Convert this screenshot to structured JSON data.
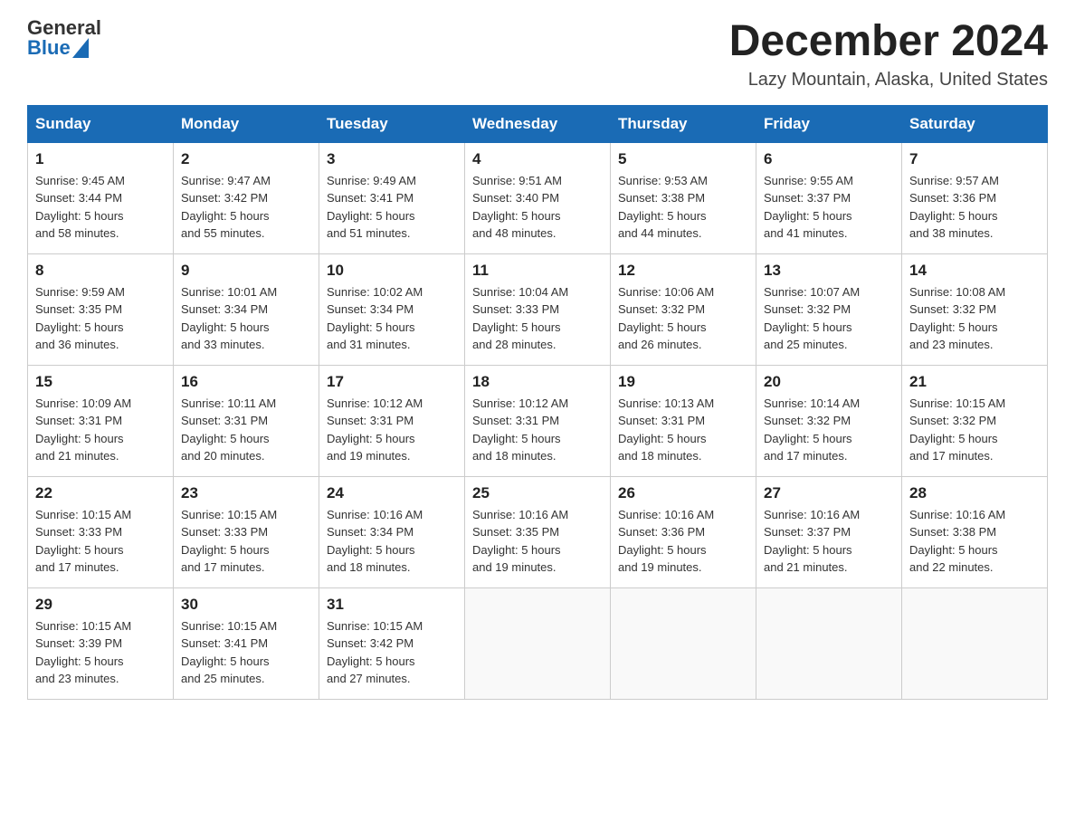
{
  "header": {
    "logo_general": "General",
    "logo_blue": "Blue",
    "month_title": "December 2024",
    "location": "Lazy Mountain, Alaska, United States"
  },
  "days_of_week": [
    "Sunday",
    "Monday",
    "Tuesday",
    "Wednesday",
    "Thursday",
    "Friday",
    "Saturday"
  ],
  "weeks": [
    [
      {
        "day": "1",
        "sunrise": "9:45 AM",
        "sunset": "3:44 PM",
        "daylight": "5 hours and 58 minutes."
      },
      {
        "day": "2",
        "sunrise": "9:47 AM",
        "sunset": "3:42 PM",
        "daylight": "5 hours and 55 minutes."
      },
      {
        "day": "3",
        "sunrise": "9:49 AM",
        "sunset": "3:41 PM",
        "daylight": "5 hours and 51 minutes."
      },
      {
        "day": "4",
        "sunrise": "9:51 AM",
        "sunset": "3:40 PM",
        "daylight": "5 hours and 48 minutes."
      },
      {
        "day": "5",
        "sunrise": "9:53 AM",
        "sunset": "3:38 PM",
        "daylight": "5 hours and 44 minutes."
      },
      {
        "day": "6",
        "sunrise": "9:55 AM",
        "sunset": "3:37 PM",
        "daylight": "5 hours and 41 minutes."
      },
      {
        "day": "7",
        "sunrise": "9:57 AM",
        "sunset": "3:36 PM",
        "daylight": "5 hours and 38 minutes."
      }
    ],
    [
      {
        "day": "8",
        "sunrise": "9:59 AM",
        "sunset": "3:35 PM",
        "daylight": "5 hours and 36 minutes."
      },
      {
        "day": "9",
        "sunrise": "10:01 AM",
        "sunset": "3:34 PM",
        "daylight": "5 hours and 33 minutes."
      },
      {
        "day": "10",
        "sunrise": "10:02 AM",
        "sunset": "3:34 PM",
        "daylight": "5 hours and 31 minutes."
      },
      {
        "day": "11",
        "sunrise": "10:04 AM",
        "sunset": "3:33 PM",
        "daylight": "5 hours and 28 minutes."
      },
      {
        "day": "12",
        "sunrise": "10:06 AM",
        "sunset": "3:32 PM",
        "daylight": "5 hours and 26 minutes."
      },
      {
        "day": "13",
        "sunrise": "10:07 AM",
        "sunset": "3:32 PM",
        "daylight": "5 hours and 25 minutes."
      },
      {
        "day": "14",
        "sunrise": "10:08 AM",
        "sunset": "3:32 PM",
        "daylight": "5 hours and 23 minutes."
      }
    ],
    [
      {
        "day": "15",
        "sunrise": "10:09 AM",
        "sunset": "3:31 PM",
        "daylight": "5 hours and 21 minutes."
      },
      {
        "day": "16",
        "sunrise": "10:11 AM",
        "sunset": "3:31 PM",
        "daylight": "5 hours and 20 minutes."
      },
      {
        "day": "17",
        "sunrise": "10:12 AM",
        "sunset": "3:31 PM",
        "daylight": "5 hours and 19 minutes."
      },
      {
        "day": "18",
        "sunrise": "10:12 AM",
        "sunset": "3:31 PM",
        "daylight": "5 hours and 18 minutes."
      },
      {
        "day": "19",
        "sunrise": "10:13 AM",
        "sunset": "3:31 PM",
        "daylight": "5 hours and 18 minutes."
      },
      {
        "day": "20",
        "sunrise": "10:14 AM",
        "sunset": "3:32 PM",
        "daylight": "5 hours and 17 minutes."
      },
      {
        "day": "21",
        "sunrise": "10:15 AM",
        "sunset": "3:32 PM",
        "daylight": "5 hours and 17 minutes."
      }
    ],
    [
      {
        "day": "22",
        "sunrise": "10:15 AM",
        "sunset": "3:33 PM",
        "daylight": "5 hours and 17 minutes."
      },
      {
        "day": "23",
        "sunrise": "10:15 AM",
        "sunset": "3:33 PM",
        "daylight": "5 hours and 17 minutes."
      },
      {
        "day": "24",
        "sunrise": "10:16 AM",
        "sunset": "3:34 PM",
        "daylight": "5 hours and 18 minutes."
      },
      {
        "day": "25",
        "sunrise": "10:16 AM",
        "sunset": "3:35 PM",
        "daylight": "5 hours and 19 minutes."
      },
      {
        "day": "26",
        "sunrise": "10:16 AM",
        "sunset": "3:36 PM",
        "daylight": "5 hours and 19 minutes."
      },
      {
        "day": "27",
        "sunrise": "10:16 AM",
        "sunset": "3:37 PM",
        "daylight": "5 hours and 21 minutes."
      },
      {
        "day": "28",
        "sunrise": "10:16 AM",
        "sunset": "3:38 PM",
        "daylight": "5 hours and 22 minutes."
      }
    ],
    [
      {
        "day": "29",
        "sunrise": "10:15 AM",
        "sunset": "3:39 PM",
        "daylight": "5 hours and 23 minutes."
      },
      {
        "day": "30",
        "sunrise": "10:15 AM",
        "sunset": "3:41 PM",
        "daylight": "5 hours and 25 minutes."
      },
      {
        "day": "31",
        "sunrise": "10:15 AM",
        "sunset": "3:42 PM",
        "daylight": "5 hours and 27 minutes."
      },
      null,
      null,
      null,
      null
    ]
  ],
  "labels": {
    "sunrise_prefix": "Sunrise: ",
    "sunset_prefix": "Sunset: ",
    "daylight_prefix": "Daylight: "
  }
}
